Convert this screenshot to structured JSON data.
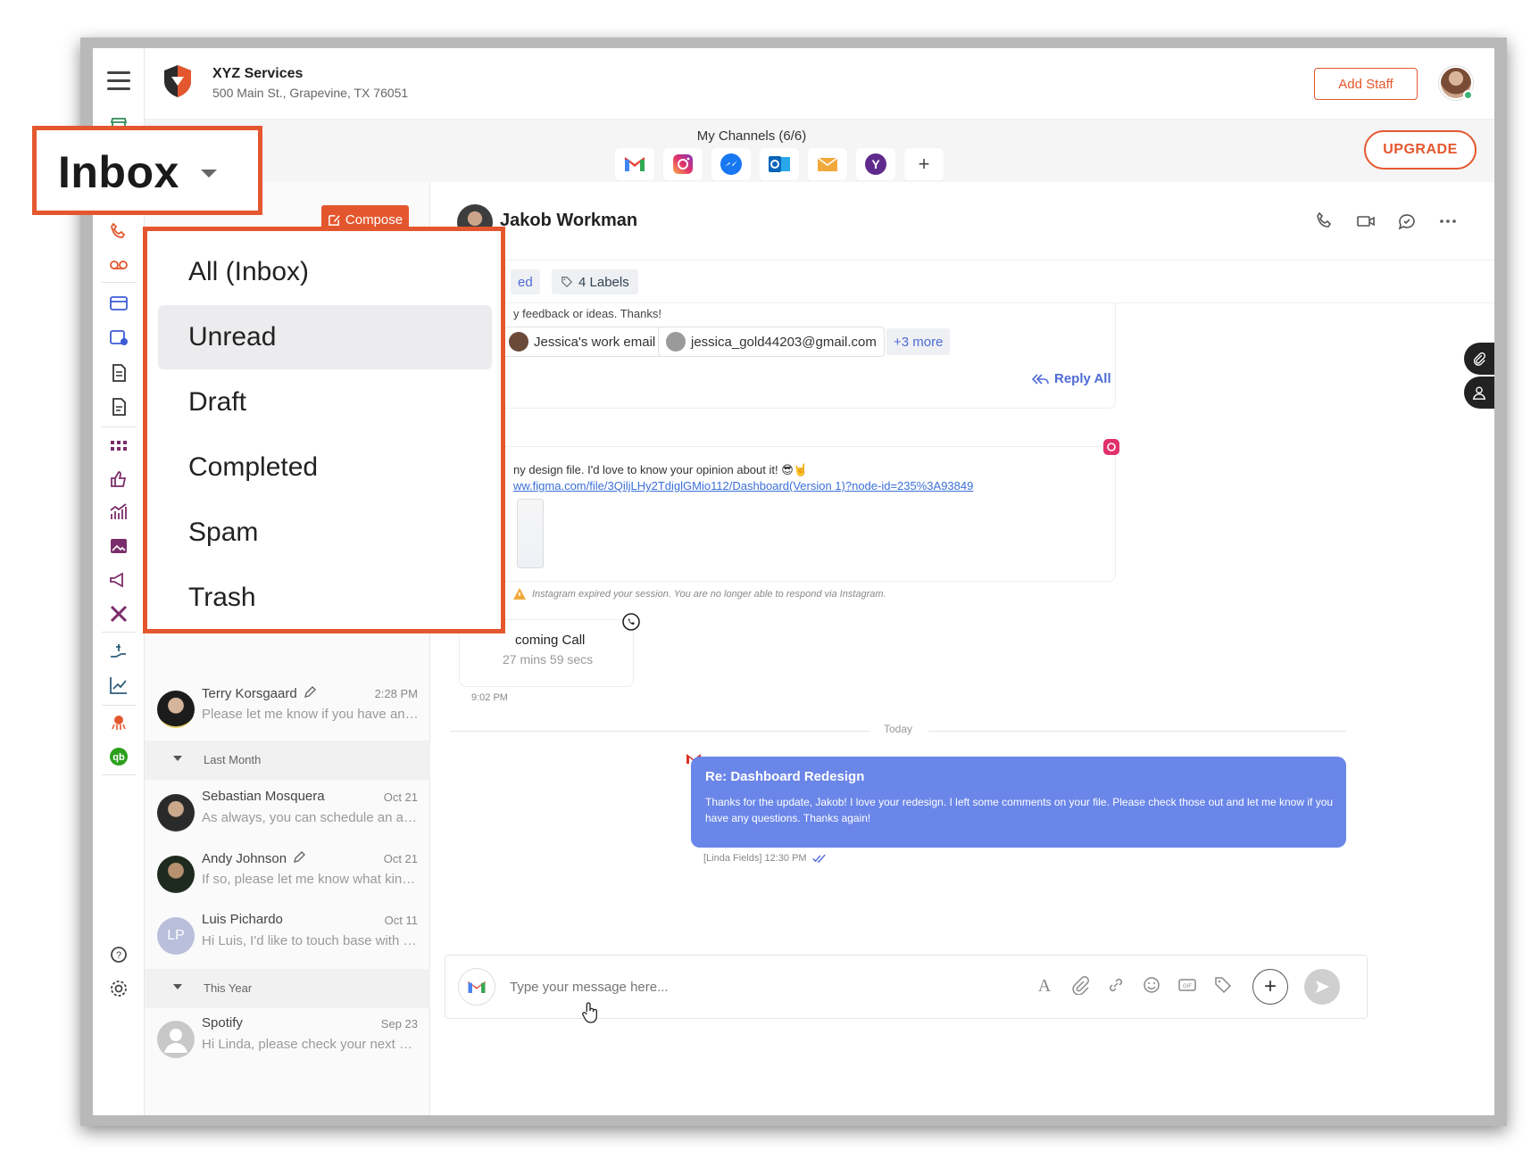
{
  "business": {
    "name": "XYZ Services",
    "address": "500 Main St., Grapevine, TX 76051"
  },
  "header": {
    "add_staff_label": "Add Staff"
  },
  "channels": {
    "title": "My Channels (6/6)",
    "icons": [
      "gmail-icon",
      "instagram-icon",
      "messenger-icon",
      "outlook-icon",
      "email-icon",
      "yahoo-icon"
    ],
    "add_label": "+"
  },
  "upgrade_label": "UPGRADE",
  "inbox_callout": {
    "label": "Inbox"
  },
  "compose_label": "Compose",
  "dropdown": {
    "items": [
      {
        "label": "All (Inbox)",
        "active": false
      },
      {
        "label": "Unread",
        "active": true
      },
      {
        "label": "Draft",
        "active": false
      },
      {
        "label": "Completed",
        "active": false
      },
      {
        "label": "Spam",
        "active": false
      },
      {
        "label": "Trash",
        "active": false
      }
    ]
  },
  "conversations": [
    {
      "name": "Terry Korsgaard",
      "time": "2:28 PM",
      "preview": "Please let me know if you have any ...",
      "draft": true
    },
    {
      "name": "Sebastian Mosquera",
      "time": "Oct 21",
      "preview": "As always, you can schedule an app...",
      "draft": false
    },
    {
      "name": "Andy Johnson",
      "time": "Oct 21",
      "preview": "If so, please let me know what kind ...",
      "draft": true
    },
    {
      "name": "Luis Pichardo",
      "time": "Oct 11",
      "preview": "Hi Luis, I'd like to touch base with y...",
      "draft": false,
      "initials": "LP"
    },
    {
      "name": "Spotify",
      "time": "Sep 23",
      "preview": "Hi Linda, please check your next m...",
      "draft": false
    }
  ],
  "sections": {
    "last_month": "Last Month",
    "this_year": "This Year"
  },
  "chat": {
    "contact_name": "Jakob Workman",
    "tag_partial": "ed",
    "labels_count": "4 Labels",
    "email_snippet": "y feedback or ideas. Thanks!",
    "recipients": [
      "Jessica's work email",
      "jessica_gold44203@gmail.com"
    ],
    "more_recipients": "+3 more",
    "reply_all": "Reply All",
    "insta_text": "ny design file. I'd love to know your opinion about it! 😎🤘",
    "insta_link": "ww.figma.com/file/3QiljLHy2TdiglGMio112/Dashboard(Version 1)?node-id=235%3A93849",
    "insta_warning": "Instagram expired your session. You are no longer able to respond via Instagram.",
    "call_title": "coming Call",
    "call_duration": "27 mins 59 secs",
    "call_time": "9:02 PM",
    "day_separator": "Today",
    "message_title": "Re: Dashboard Redesign",
    "message_body": "Thanks for the update, Jakob! I love your redesign. I left some comments on your file. Please check those out and let me know if you have any questions. Thanks again!",
    "message_meta": "[Linda Fields] 12:30 PM",
    "composer_placeholder": "Type your message here..."
  },
  "colors": {
    "accent": "#e4572e",
    "bubble": "#6a86e8",
    "link": "#4f6bd6"
  }
}
